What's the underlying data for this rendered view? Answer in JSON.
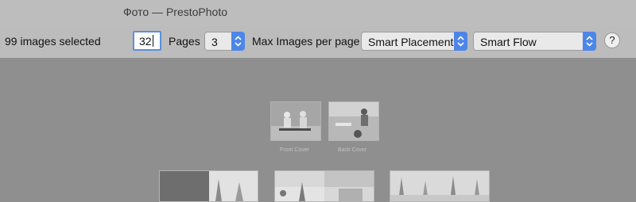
{
  "window": {
    "title": "Фото — PrestoPhoto"
  },
  "toolbar": {
    "selection_text": "99 images selected",
    "pages_value": "32",
    "pages_label": "Pages",
    "max_images_value": "3",
    "max_images_label": "Max Images per page",
    "placement_select": "Smart Placement",
    "flow_select": "Smart Flow",
    "help_label": "?"
  },
  "canvas": {
    "front_cover_label": "Front Cover",
    "back_cover_label": "Back Cover"
  },
  "icons": [
    "help-icon",
    "stepper-arrows-icon",
    "select-arrows-icon"
  ],
  "colors": {
    "accent": "#4d86e8",
    "canvas_bg": "#8f8f8f",
    "toolbar_bg": "#bcbcbc"
  }
}
